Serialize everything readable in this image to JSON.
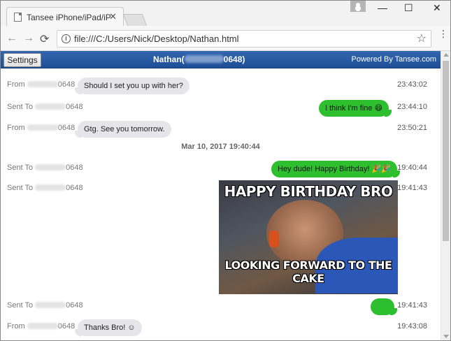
{
  "browser": {
    "tab_title": "Tansee iPhone/iPad/iPod",
    "tab_close": "✕",
    "url": "file:///C:/Users/Nick/Desktop/Nathan.html",
    "window_controls": {
      "minimize": "—",
      "maximize": "☐",
      "close": "✕"
    },
    "nav": {
      "back": "←",
      "forward": "→",
      "reload": "⟳"
    },
    "star": "☆",
    "info": "i",
    "menu": "⋮"
  },
  "header": {
    "settings_label": "Settings",
    "contact_prefix": "Nathan(",
    "contact_suffix": "0648)",
    "powered_by": "Powered By Tansee.com"
  },
  "messages": [
    {
      "direction": "From",
      "number_suffix": "0648",
      "text": "Should I set you up with her?",
      "time": "23:43:02"
    },
    {
      "direction": "Sent To",
      "number_suffix": "0648",
      "text": "I think I'm fine 😄",
      "time": "23:44:10"
    },
    {
      "direction": "From",
      "number_suffix": "0648",
      "text": "Gtg. See you tomorrow.",
      "time": "23:50:21"
    },
    {
      "direction": "Sent To",
      "number_suffix": "0648",
      "text": "Hey dude! Happy Birthday! 🎉🎉",
      "time": "19:40:44"
    },
    {
      "direction": "Sent To",
      "number_suffix": "0648",
      "text": "",
      "time": "19:41:43"
    },
    {
      "direction": "Sent To",
      "number_suffix": "0648",
      "text": "",
      "time": "19:41:43"
    },
    {
      "direction": "From",
      "number_suffix": "0648",
      "text": "Thanks Bro! ☺",
      "time": "19:43:08"
    }
  ],
  "date_separator": "Mar 10, 2017 19:40:44",
  "meme": {
    "top_text": "HAPPY BIRTHDAY BRO",
    "bottom_text": "LOOKING FORWARD TO THE CAKE"
  },
  "colors": {
    "header_blue": "#1d4e96",
    "sent_bubble": "#2ebf2e",
    "received_bubble": "#e6e5ea"
  }
}
